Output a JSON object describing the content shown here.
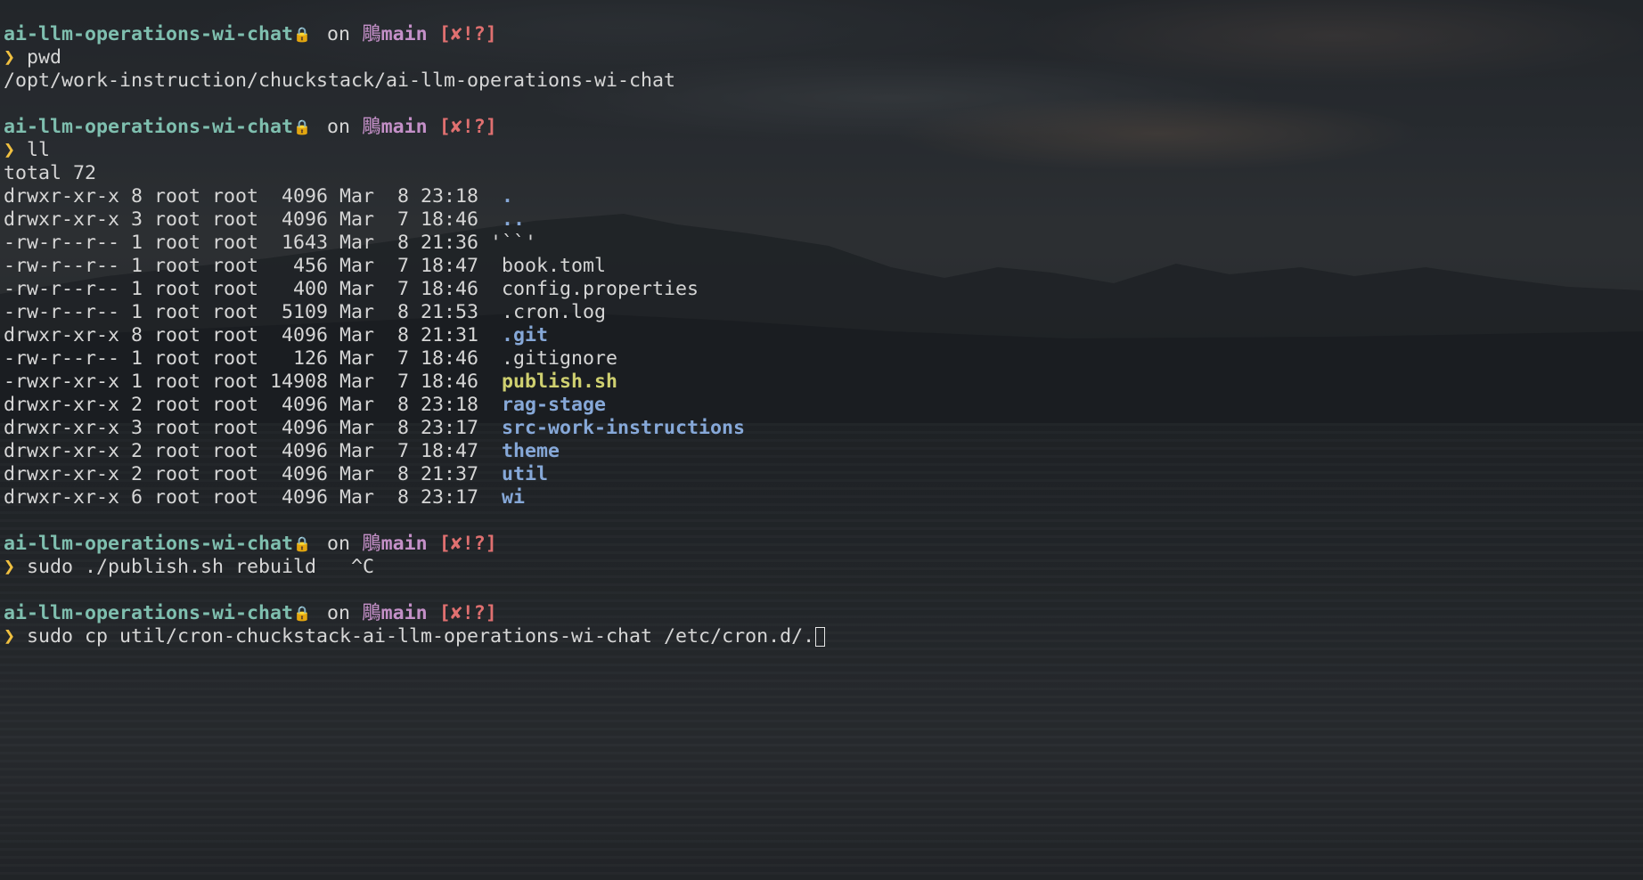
{
  "prompt": {
    "directory": "ai-llm-operations-wi-chat",
    "lock_icon": "lock-icon",
    "on_word": "on",
    "branch_icon": "git-branch-icon",
    "branch_glyph": "鵰",
    "branch": "main",
    "status": "[✘!?]",
    "chevron": "❯"
  },
  "session": [
    {
      "command": "pwd",
      "output": [
        "/opt/work-instruction/chuckstack/ai-llm-operations-wi-chat"
      ]
    },
    {
      "command": "ll",
      "output_total": "total 72"
    },
    {
      "command": "sudo ./publish.sh rebuild   ^C"
    },
    {
      "command": "sudo cp util/cron-chuckstack-ai-llm-operations-wi-chat /etc/cron.d/."
    }
  ],
  "listing": [
    {
      "meta": "drwxr-xr-x 8 root root  4096 Mar  8 23:18  ",
      "name": ".",
      "kind": "dir"
    },
    {
      "meta": "drwxr-xr-x 3 root root  4096 Mar  7 18:46  ",
      "name": "..",
      "kind": "dir"
    },
    {
      "meta": "-rw-r--r-- 1 root root  1643 Mar  8 21:36 ",
      "name": "'``'",
      "kind": "plain"
    },
    {
      "meta": "-rw-r--r-- 1 root root   456 Mar  7 18:47  ",
      "name": "book.toml",
      "kind": "plain"
    },
    {
      "meta": "-rw-r--r-- 1 root root   400 Mar  7 18:46  ",
      "name": "config.properties",
      "kind": "plain"
    },
    {
      "meta": "-rw-r--r-- 1 root root  5109 Mar  8 21:53  ",
      "name": ".cron.log",
      "kind": "plain"
    },
    {
      "meta": "drwxr-xr-x 8 root root  4096 Mar  8 21:31  ",
      "name": ".git",
      "kind": "dir"
    },
    {
      "meta": "-rw-r--r-- 1 root root   126 Mar  7 18:46  ",
      "name": ".gitignore",
      "kind": "plain"
    },
    {
      "meta": "-rwxr-xr-x 1 root root 14908 Mar  7 18:46  ",
      "name": "publish.sh",
      "kind": "exec"
    },
    {
      "meta": "drwxr-xr-x 2 root root  4096 Mar  8 23:18  ",
      "name": "rag-stage",
      "kind": "dir"
    },
    {
      "meta": "drwxr-xr-x 3 root root  4096 Mar  8 23:17  ",
      "name": "src-work-instructions",
      "kind": "dir"
    },
    {
      "meta": "drwxr-xr-x 2 root root  4096 Mar  7 18:47  ",
      "name": "theme",
      "kind": "dir"
    },
    {
      "meta": "drwxr-xr-x 2 root root  4096 Mar  8 21:37  ",
      "name": "util",
      "kind": "dir"
    },
    {
      "meta": "drwxr-xr-x 6 root root  4096 Mar  8 23:17  ",
      "name": "wi",
      "kind": "dir"
    }
  ],
  "colors": {
    "directory": "#7fbfaf",
    "branch": "#c490c8",
    "status": "#e07070",
    "chevron": "#f0c040",
    "dir_entry": "#86a8d8",
    "exec_entry": "#cfd070",
    "text": "#d6d6d6"
  }
}
